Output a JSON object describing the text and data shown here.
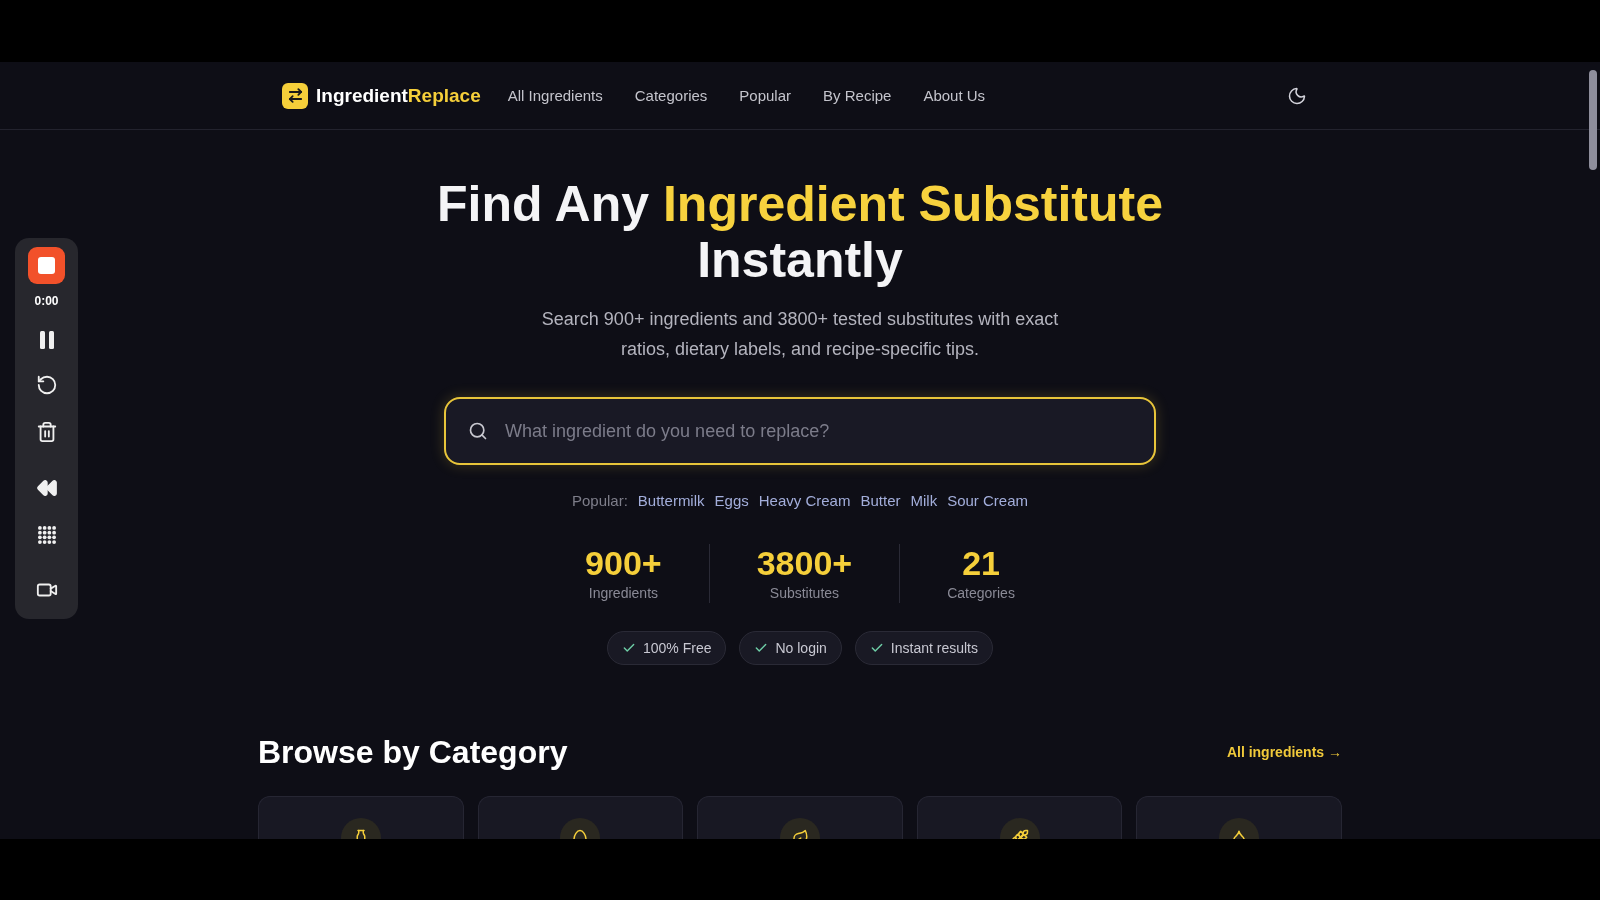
{
  "recorder_toolbar": {
    "timer": "0:00"
  },
  "header": {
    "logo": {
      "name": "Ingredient",
      "accent": "Replace"
    },
    "nav": [
      "All Ingredients",
      "Categories",
      "Popular",
      "By Recipe",
      "About Us"
    ]
  },
  "hero": {
    "title": {
      "lead": "Find Any",
      "highlight": "Ingredient Substitute",
      "tail": "Instantly"
    },
    "subtitle": "Search 900+ ingredients and 3800+ tested substitutes with exact ratios, dietary labels, and recipe-specific tips.",
    "search": {
      "placeholder": "What ingredient do you need to replace?"
    },
    "popular": {
      "label": "Popular:",
      "items": [
        "Buttermilk",
        "Eggs",
        "Heavy Cream",
        "Butter",
        "Milk",
        "Sour Cream"
      ]
    },
    "stats": [
      {
        "value": "900+",
        "label": "Ingredients"
      },
      {
        "value": "3800+",
        "label": "Substitutes"
      },
      {
        "value": "21",
        "label": "Categories"
      }
    ],
    "badges": [
      "100% Free",
      "No login",
      "Instant results"
    ]
  },
  "categories": {
    "title": "Browse by Category",
    "link": "All ingredients →",
    "cards": [
      {
        "kind": "bottle"
      },
      {
        "kind": "egg"
      },
      {
        "kind": "leaf"
      },
      {
        "kind": "grain"
      },
      {
        "kind": "drop"
      }
    ]
  }
}
